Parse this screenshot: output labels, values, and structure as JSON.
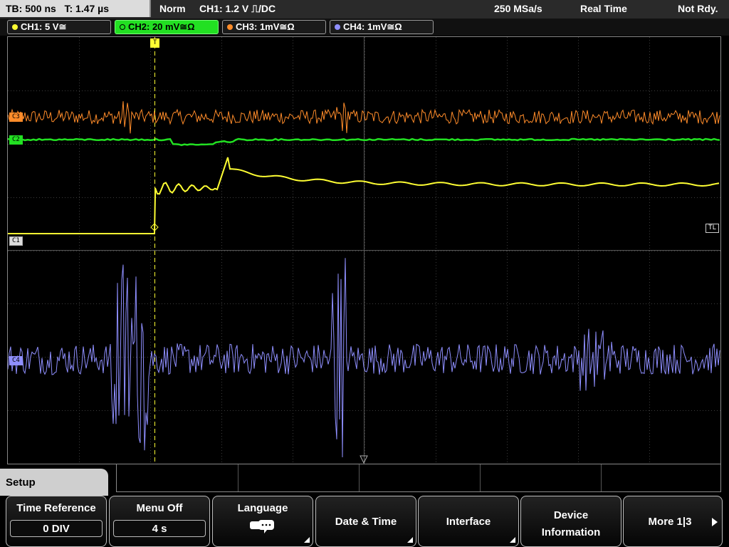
{
  "status": {
    "timebase": "TB: 500 ns",
    "trigger_time": "T: 1.47 µs",
    "mode": "Norm",
    "trigger_info": "CH1: 1.2 V ⎍/DC",
    "sample_rate": "250 MSa/s",
    "acq_mode": "Real Time",
    "state": "Not Rdy."
  },
  "channels": [
    {
      "label": "CH1: 5 V≅",
      "color": "#ffff33"
    },
    {
      "label": "CH2: 20 mV≅Ω",
      "color": "#22e022"
    },
    {
      "label": "CH3: 1mV≅Ω",
      "color": "#ff8c2a"
    },
    {
      "label": "CH4: 1mV≅Ω",
      "color": "#8f8fff"
    }
  ],
  "markers": {
    "c1": "C1",
    "c2": "C2",
    "c3": "C3",
    "c4": "C4",
    "trigger_level": "TL",
    "trigger_pos": "T"
  },
  "menu": {
    "title": "Setup",
    "softkeys": [
      {
        "label": "Time Reference",
        "value": "0 DIV"
      },
      {
        "label": "Menu Off",
        "value": "4 s"
      },
      {
        "label": "Language",
        "icon": "speech-bubble-icon"
      },
      {
        "label": "Date & Time"
      },
      {
        "label": "Interface"
      },
      {
        "label": "Device",
        "label2": "Information"
      },
      {
        "label": "More 1|3"
      }
    ]
  }
}
